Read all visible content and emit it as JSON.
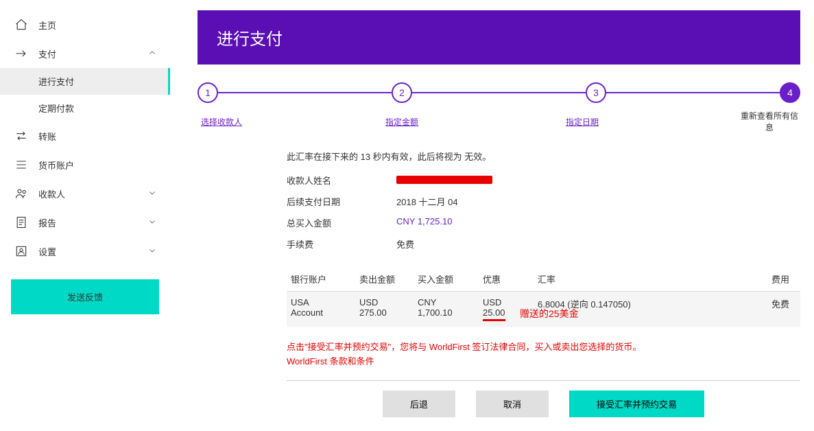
{
  "sidebar": {
    "home": "主页",
    "pay": "支付",
    "make_payment": "进行支付",
    "scheduled": "定期付款",
    "transfer": "转账",
    "currency_acct": "货币账户",
    "payee": "收款人",
    "report": "报告",
    "settings": "设置",
    "feedback": "发送反馈"
  },
  "header": {
    "title": "进行支付"
  },
  "steps": {
    "s1": {
      "num": "1",
      "label": "选择收款人"
    },
    "s2": {
      "num": "2",
      "label": "指定金额"
    },
    "s3": {
      "num": "3",
      "label": "指定日期"
    },
    "s4": {
      "num": "4",
      "label": "重新查看所有信息"
    }
  },
  "body": {
    "notice_a": "此汇率在接下来的 13 秒内有效，此后将视为 无效。",
    "payee_k": "收款人姓名",
    "date_k": "后续支付日期",
    "date_v": "2018 十二月 04",
    "total_k": "总买入金额",
    "total_v": "CNY 1,725.10",
    "fee_k": "手续费",
    "fee_v": "免费"
  },
  "table": {
    "h1": "银行账户",
    "h2": "卖出金额",
    "h3": "买入金额",
    "h4": "优惠",
    "h5": "汇率",
    "h6": "费用",
    "r1": {
      "acct_l1": "USA",
      "acct_l2": "Account",
      "sell_l1": "USD",
      "sell_l2": "275.00",
      "buy_l1": "CNY",
      "buy_l2": "1,700.10",
      "disc_l1": "USD",
      "disc_l2": "25.00",
      "rate": "6.8004 (逆向 0.147050)",
      "fee": "免费"
    },
    "annot": "赠送的25美金"
  },
  "legal": {
    "line1": "点击\"接受汇率并预约交易\"，您将与 WorldFirst 签订法律合同，买入或卖出您选择的货币。",
    "line2": "WorldFirst 条款和条件"
  },
  "buttons": {
    "back": "后退",
    "cancel": "取消",
    "confirm": "接受汇率并预约交易"
  }
}
